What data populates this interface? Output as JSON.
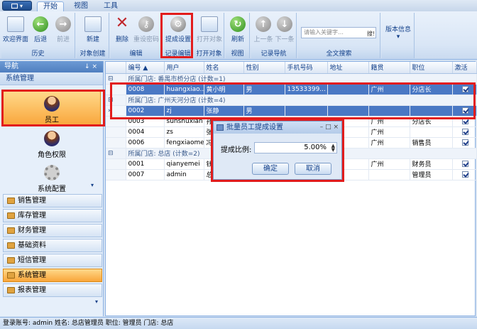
{
  "app_button": {
    "label": ""
  },
  "tabs": [
    "开始",
    "视图",
    "工具"
  ],
  "ribbon": {
    "groups": [
      {
        "label": "历史",
        "buttons": [
          "欢迎界面",
          "后退",
          "前进"
        ]
      },
      {
        "label": "对象创建",
        "buttons": [
          "新建"
        ]
      },
      {
        "label": "编辑",
        "buttons": [
          "删除",
          "重设密码"
        ]
      },
      {
        "label": "记录编辑",
        "buttons": [
          "提成设置"
        ]
      },
      {
        "label": "打开对象",
        "buttons": [
          "打开对象"
        ]
      },
      {
        "label": "视图",
        "buttons": [
          "刷新"
        ]
      },
      {
        "label": "记录导航",
        "buttons": [
          "上一条",
          "下一条"
        ]
      },
      {
        "label": "全文搜索",
        "search_placeholder": "请输入关键字…",
        "search_button": "搜!"
      },
      {
        "label": "",
        "buttons": [
          "版本信息"
        ]
      }
    ]
  },
  "nav": {
    "header": "导航",
    "header_pin": "↓ ×",
    "section": "系统管理",
    "items": [
      "员工",
      "角色权限",
      "系统配置"
    ],
    "categories": [
      "销售管理",
      "库存管理",
      "财务管理",
      "基础资料",
      "短信管理",
      "系统管理",
      "报表管理"
    ],
    "active_category": "系统管理"
  },
  "grid": {
    "columns": [
      "编号",
      "用户",
      "姓名",
      "性别",
      "手机号码",
      "地址",
      "籍贯",
      "职位",
      "激活"
    ],
    "rows": [
      {
        "type": "group",
        "text": "所属门店: 番禺市桥分店 (计数=1)"
      },
      {
        "type": "data",
        "cells": [
          "0008",
          "huangxiao...",
          "黄小明",
          "男",
          "13533399...",
          "",
          "广州",
          "分店长",
          ""
        ],
        "active": true,
        "selected": true
      },
      {
        "type": "group",
        "text": "所属门店: 广州天河分店 (计数=4)"
      },
      {
        "type": "data",
        "cells": [
          "0002",
          "zj",
          "张静",
          "男",
          "",
          "",
          "",
          "",
          ""
        ],
        "active": true,
        "selected": true,
        "current": true
      },
      {
        "type": "data",
        "cells": [
          "0003",
          "sunshuxian",
          "孙书贤",
          "",
          "",
          "",
          "广州",
          "分店长",
          ""
        ],
        "active": true
      },
      {
        "type": "data",
        "cells": [
          "0004",
          "zs",
          "张三",
          "",
          "",
          "",
          "广州",
          "",
          ""
        ],
        "active": true
      },
      {
        "type": "data",
        "cells": [
          "0006",
          "fengxiaomei",
          "冯小梅",
          "",
          "",
          "",
          "广州",
          "销售员",
          ""
        ],
        "active": true
      },
      {
        "type": "group",
        "text": "所属门店: 总店 (计数=2)"
      },
      {
        "type": "data",
        "cells": [
          "0001",
          "qianyemei",
          "钱叶梅",
          "",
          "",
          "",
          "广州",
          "财务员",
          ""
        ],
        "active": true
      },
      {
        "type": "data",
        "cells": [
          "0007",
          "admin",
          "总店管理",
          "",
          "",
          "",
          "",
          "管理员",
          ""
        ],
        "active": true
      }
    ]
  },
  "dialog": {
    "title": "批量员工提成设置",
    "controls": "– □ ×",
    "label": "提成比例:",
    "value": "5.00%",
    "ok": "确定",
    "cancel": "取消"
  },
  "status": "登录账号: admin 姓名: 总店管理员 职位: 管理员 门店: 总店"
}
